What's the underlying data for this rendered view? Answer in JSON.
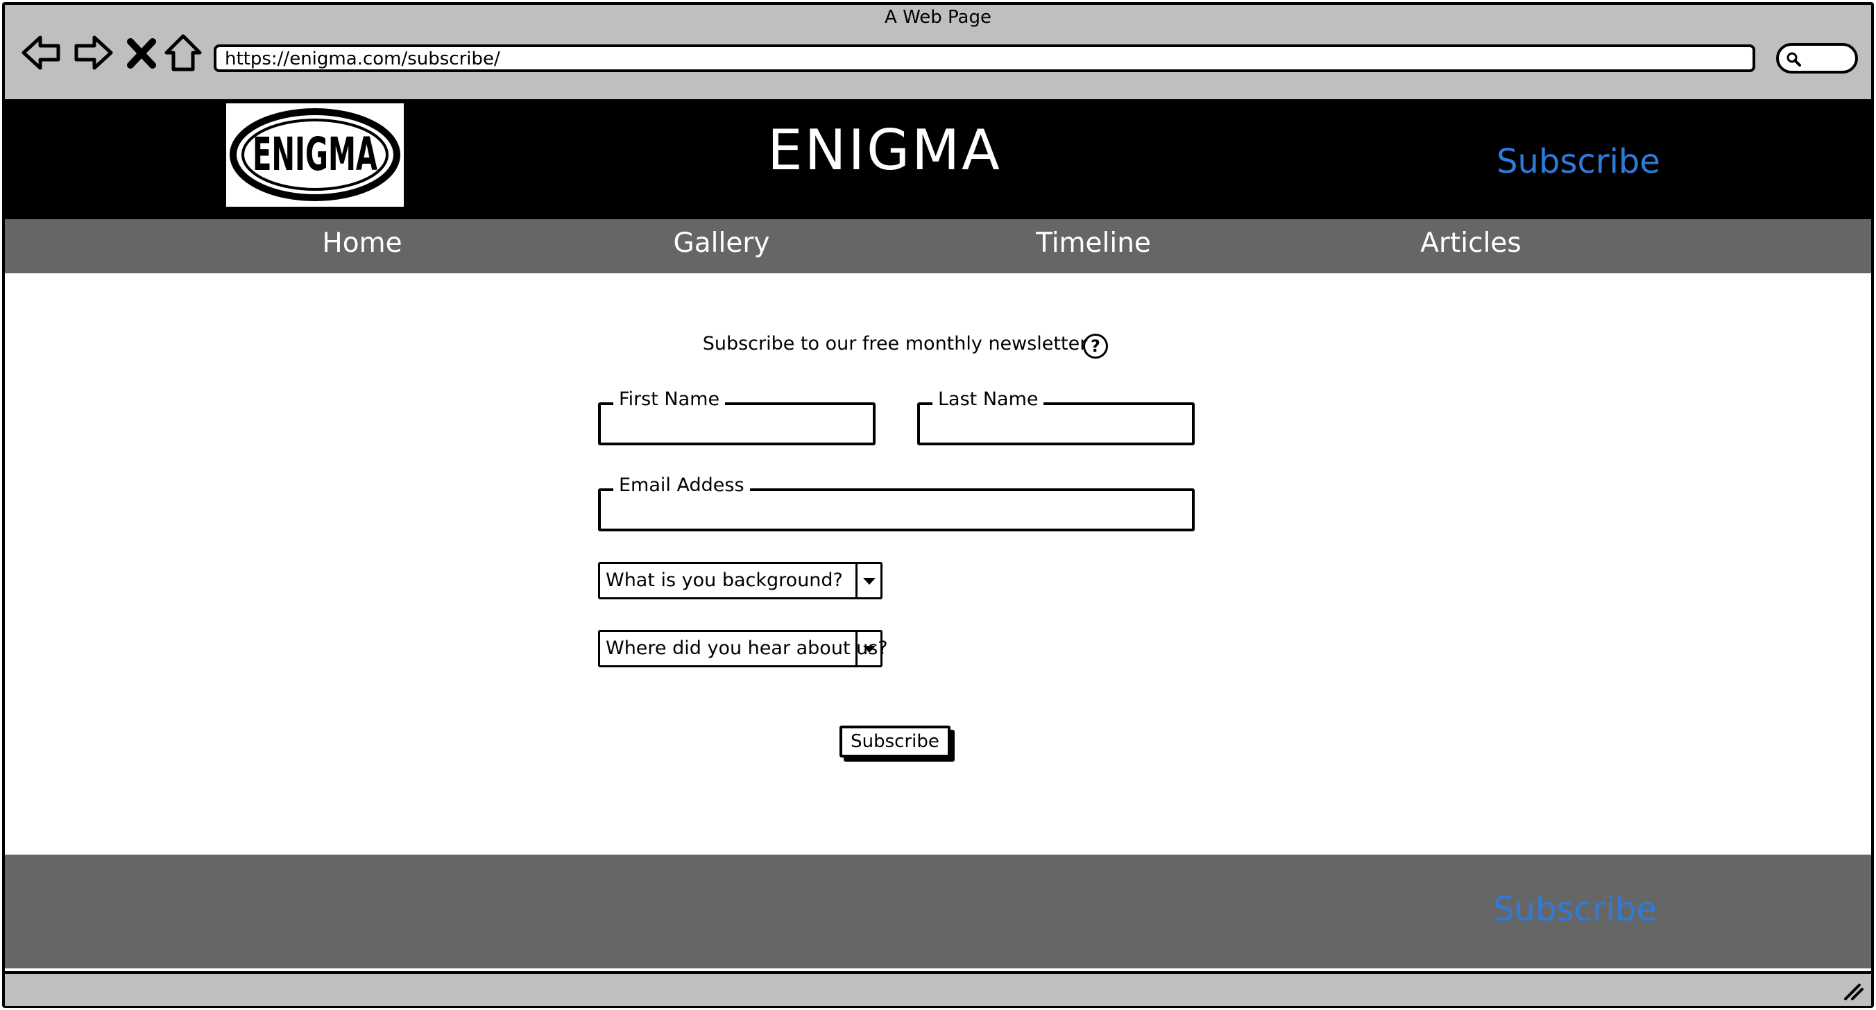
{
  "window": {
    "title": "A Web Page"
  },
  "browser": {
    "url": "https://enigma.com/subscribe/",
    "buttons": {
      "back": "back-arrow-icon",
      "forward": "forward-arrow-icon",
      "stop": "close-icon",
      "home": "home-icon"
    },
    "search_icon": "search-icon"
  },
  "header": {
    "logo_text": "ENIGMA",
    "title": "ENIGMA",
    "subscribe_link": "Subscribe",
    "link_color": "#2f7bd9"
  },
  "nav": {
    "items": [
      {
        "label": "Home"
      },
      {
        "label": "Gallery"
      },
      {
        "label": "Timeline"
      },
      {
        "label": "Articles"
      }
    ]
  },
  "form": {
    "heading": "Subscribe to our free monthly newsletter",
    "help_icon": "?",
    "first_name": {
      "label": "First Name",
      "value": ""
    },
    "last_name": {
      "label": "Last Name",
      "value": ""
    },
    "email": {
      "label": "Email Addess",
      "value": ""
    },
    "background_select": {
      "value": "What is you background?"
    },
    "referral_select": {
      "value": "Where did you hear about us?"
    },
    "submit_label": "Subscribe"
  },
  "footer": {
    "subscribe_link": "Subscribe"
  }
}
